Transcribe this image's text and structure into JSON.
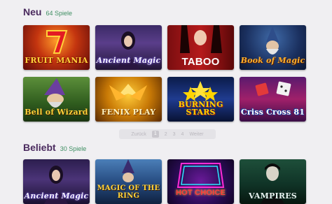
{
  "sections": [
    {
      "title": "Neu",
      "count": "64 Spiele",
      "games": [
        {
          "name": "FRUIT MANIA"
        },
        {
          "name": "Ancient Magic"
        },
        {
          "name": "TABOO"
        },
        {
          "name": "Book of Magic"
        },
        {
          "name": "Bell of Wizard"
        },
        {
          "name": "FENIX PLAY"
        },
        {
          "name": "BURNING STARS"
        },
        {
          "name": "Criss Cross 81"
        }
      ]
    },
    {
      "title": "Beliebt",
      "count": "30 Spiele",
      "games": [
        {
          "name": "Ancient Magic"
        },
        {
          "name": "MAGIC OF THE RING"
        },
        {
          "name": "HOT CHOICE"
        },
        {
          "name": "VAMPIRES"
        }
      ]
    }
  ],
  "pager": {
    "prev": "Zurück",
    "current": "1",
    "pages": [
      "2",
      "3",
      "4"
    ],
    "next": "Weiter"
  }
}
